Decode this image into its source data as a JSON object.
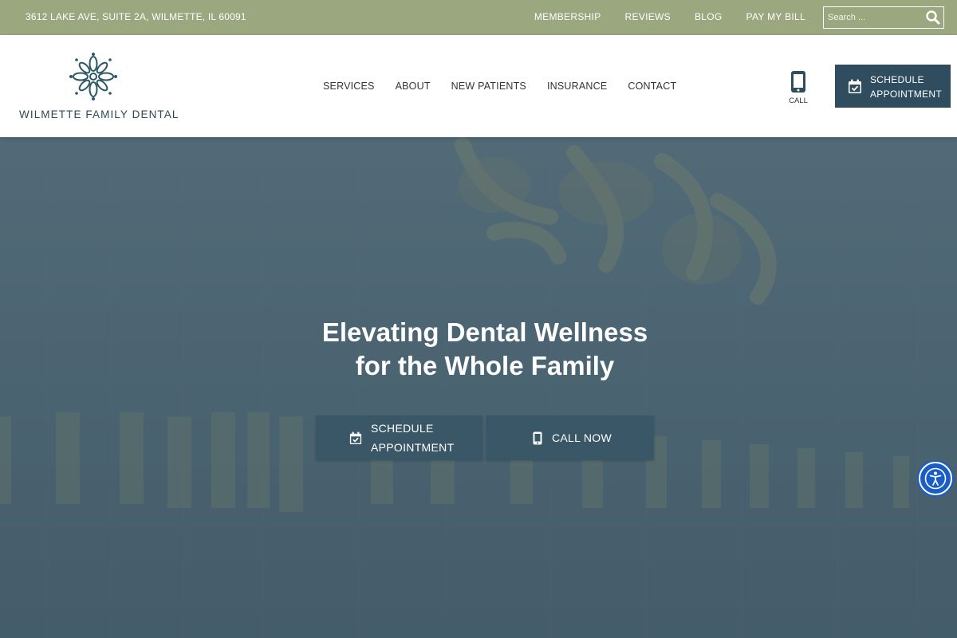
{
  "topbar": {
    "address": "3612 LAKE AVE, SUITE 2A, WILMETTE, IL 60091",
    "links": [
      "MEMBERSHIP",
      "REVIEWS",
      "BLOG",
      "PAY MY BILL"
    ],
    "search_placeholder": "Search ..."
  },
  "header": {
    "brand": "WILMETTE FAMILY DENTAL",
    "nav": [
      "SERVICES",
      "ABOUT",
      "NEW PATIENTS",
      "INSURANCE",
      "CONTACT"
    ],
    "call_label": "CALL",
    "schedule_label": "SCHEDULE APPOINTMENT"
  },
  "hero": {
    "title_line1": "Elevating Dental Wellness",
    "title_line2": "for the Whole Family",
    "schedule_button": "SCHEDULE APPOINTMENT",
    "call_button": "CALL NOW"
  },
  "colors": {
    "topbar": "#9aa77f",
    "primary": "#2f4d5e",
    "hero_overlay": "#4e6674",
    "accessibility": "#1a5dc7"
  },
  "icons": {
    "search": "search-icon",
    "phone": "phone-icon",
    "calendar": "calendar-check-icon",
    "accessibility": "accessibility-icon",
    "logo": "mandala-logo-icon"
  }
}
